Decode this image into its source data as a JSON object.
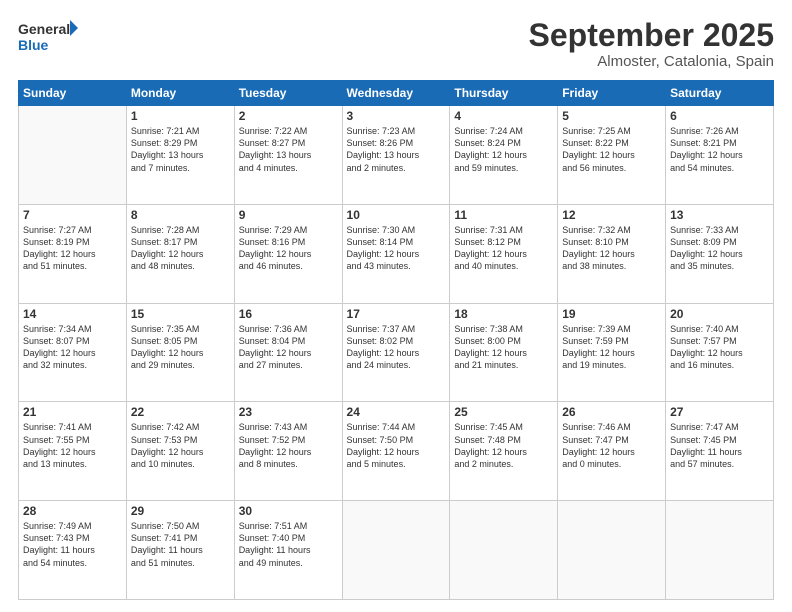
{
  "logo": {
    "line1": "General",
    "line2": "Blue"
  },
  "title": "September 2025",
  "subtitle": "Almoster, Catalonia, Spain",
  "weekdays": [
    "Sunday",
    "Monday",
    "Tuesday",
    "Wednesday",
    "Thursday",
    "Friday",
    "Saturday"
  ],
  "weeks": [
    [
      {
        "day": "",
        "info": ""
      },
      {
        "day": "1",
        "info": "Sunrise: 7:21 AM\nSunset: 8:29 PM\nDaylight: 13 hours\nand 7 minutes."
      },
      {
        "day": "2",
        "info": "Sunrise: 7:22 AM\nSunset: 8:27 PM\nDaylight: 13 hours\nand 4 minutes."
      },
      {
        "day": "3",
        "info": "Sunrise: 7:23 AM\nSunset: 8:26 PM\nDaylight: 13 hours\nand 2 minutes."
      },
      {
        "day": "4",
        "info": "Sunrise: 7:24 AM\nSunset: 8:24 PM\nDaylight: 12 hours\nand 59 minutes."
      },
      {
        "day": "5",
        "info": "Sunrise: 7:25 AM\nSunset: 8:22 PM\nDaylight: 12 hours\nand 56 minutes."
      },
      {
        "day": "6",
        "info": "Sunrise: 7:26 AM\nSunset: 8:21 PM\nDaylight: 12 hours\nand 54 minutes."
      }
    ],
    [
      {
        "day": "7",
        "info": "Sunrise: 7:27 AM\nSunset: 8:19 PM\nDaylight: 12 hours\nand 51 minutes."
      },
      {
        "day": "8",
        "info": "Sunrise: 7:28 AM\nSunset: 8:17 PM\nDaylight: 12 hours\nand 48 minutes."
      },
      {
        "day": "9",
        "info": "Sunrise: 7:29 AM\nSunset: 8:16 PM\nDaylight: 12 hours\nand 46 minutes."
      },
      {
        "day": "10",
        "info": "Sunrise: 7:30 AM\nSunset: 8:14 PM\nDaylight: 12 hours\nand 43 minutes."
      },
      {
        "day": "11",
        "info": "Sunrise: 7:31 AM\nSunset: 8:12 PM\nDaylight: 12 hours\nand 40 minutes."
      },
      {
        "day": "12",
        "info": "Sunrise: 7:32 AM\nSunset: 8:10 PM\nDaylight: 12 hours\nand 38 minutes."
      },
      {
        "day": "13",
        "info": "Sunrise: 7:33 AM\nSunset: 8:09 PM\nDaylight: 12 hours\nand 35 minutes."
      }
    ],
    [
      {
        "day": "14",
        "info": "Sunrise: 7:34 AM\nSunset: 8:07 PM\nDaylight: 12 hours\nand 32 minutes."
      },
      {
        "day": "15",
        "info": "Sunrise: 7:35 AM\nSunset: 8:05 PM\nDaylight: 12 hours\nand 29 minutes."
      },
      {
        "day": "16",
        "info": "Sunrise: 7:36 AM\nSunset: 8:04 PM\nDaylight: 12 hours\nand 27 minutes."
      },
      {
        "day": "17",
        "info": "Sunrise: 7:37 AM\nSunset: 8:02 PM\nDaylight: 12 hours\nand 24 minutes."
      },
      {
        "day": "18",
        "info": "Sunrise: 7:38 AM\nSunset: 8:00 PM\nDaylight: 12 hours\nand 21 minutes."
      },
      {
        "day": "19",
        "info": "Sunrise: 7:39 AM\nSunset: 7:59 PM\nDaylight: 12 hours\nand 19 minutes."
      },
      {
        "day": "20",
        "info": "Sunrise: 7:40 AM\nSunset: 7:57 PM\nDaylight: 12 hours\nand 16 minutes."
      }
    ],
    [
      {
        "day": "21",
        "info": "Sunrise: 7:41 AM\nSunset: 7:55 PM\nDaylight: 12 hours\nand 13 minutes."
      },
      {
        "day": "22",
        "info": "Sunrise: 7:42 AM\nSunset: 7:53 PM\nDaylight: 12 hours\nand 10 minutes."
      },
      {
        "day": "23",
        "info": "Sunrise: 7:43 AM\nSunset: 7:52 PM\nDaylight: 12 hours\nand 8 minutes."
      },
      {
        "day": "24",
        "info": "Sunrise: 7:44 AM\nSunset: 7:50 PM\nDaylight: 12 hours\nand 5 minutes."
      },
      {
        "day": "25",
        "info": "Sunrise: 7:45 AM\nSunset: 7:48 PM\nDaylight: 12 hours\nand 2 minutes."
      },
      {
        "day": "26",
        "info": "Sunrise: 7:46 AM\nSunset: 7:47 PM\nDaylight: 12 hours\nand 0 minutes."
      },
      {
        "day": "27",
        "info": "Sunrise: 7:47 AM\nSunset: 7:45 PM\nDaylight: 11 hours\nand 57 minutes."
      }
    ],
    [
      {
        "day": "28",
        "info": "Sunrise: 7:49 AM\nSunset: 7:43 PM\nDaylight: 11 hours\nand 54 minutes."
      },
      {
        "day": "29",
        "info": "Sunrise: 7:50 AM\nSunset: 7:41 PM\nDaylight: 11 hours\nand 51 minutes."
      },
      {
        "day": "30",
        "info": "Sunrise: 7:51 AM\nSunset: 7:40 PM\nDaylight: 11 hours\nand 49 minutes."
      },
      {
        "day": "",
        "info": ""
      },
      {
        "day": "",
        "info": ""
      },
      {
        "day": "",
        "info": ""
      },
      {
        "day": "",
        "info": ""
      }
    ]
  ]
}
